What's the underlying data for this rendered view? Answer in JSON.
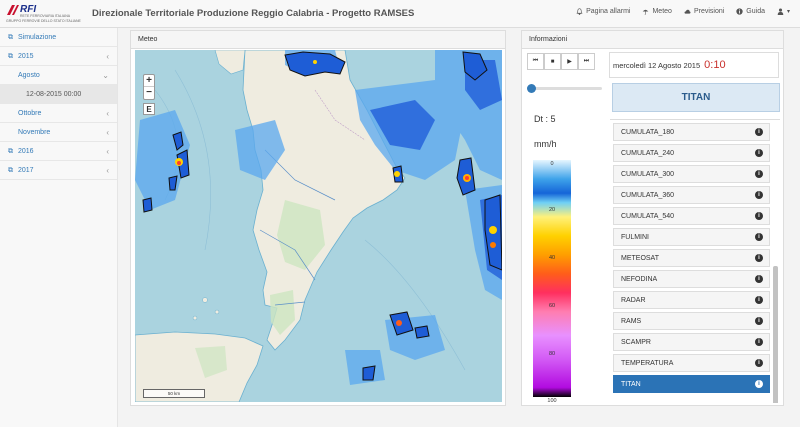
{
  "header": {
    "logo_text": "RFI",
    "logo_sub1": "RETE FERROVIARIA ITALIANA",
    "logo_sub2": "GRUPPO FERROVIE DELLO STATO ITALIANE",
    "title": "Direzionale Territoriale Produzione Reggio Calabria - Progetto RAMSES",
    "nav": [
      {
        "label": "Pagina allarmi",
        "icon": "bell-icon"
      },
      {
        "label": "Meteo",
        "icon": "umbrella-icon"
      },
      {
        "label": "Previsioni",
        "icon": "cloud-icon"
      },
      {
        "label": "Guida",
        "icon": "info-icon"
      },
      {
        "label": "",
        "icon": "user-icon"
      }
    ]
  },
  "sidebar": {
    "items": [
      {
        "label": "Simulazione",
        "level": 1,
        "icon": "sitemap-icon"
      },
      {
        "label": "2015",
        "level": 1,
        "icon": "sitemap-icon"
      },
      {
        "label": "Agosto",
        "level": 2
      },
      {
        "label": "12-08-2015 00:00",
        "level": 3
      },
      {
        "label": "Ottobre",
        "level": 2
      },
      {
        "label": "Novembre",
        "level": 2
      },
      {
        "label": "2016",
        "level": 1,
        "icon": "sitemap-icon"
      },
      {
        "label": "2017",
        "level": 1,
        "icon": "sitemap-icon"
      }
    ]
  },
  "meteo": {
    "title": "Meteo",
    "zoom_in": "+",
    "zoom_out": "−",
    "layer_btn": "E",
    "scale_label": "50 km"
  },
  "info": {
    "title": "Informazioni",
    "date": "mercoledì 12 Agosto 2015",
    "time": "0:10",
    "titan_label": "TITAN",
    "dt": "Dt : 5",
    "unit": "mm/h",
    "colorbar_ticks": [
      "0",
      "20",
      "40",
      "60",
      "80",
      "100"
    ],
    "slider_position": 0,
    "layers": [
      {
        "label": "CUMULATA_180",
        "active": false
      },
      {
        "label": "CUMULATA_240",
        "active": false
      },
      {
        "label": "CUMULATA_300",
        "active": false
      },
      {
        "label": "CUMULATA_360",
        "active": false
      },
      {
        "label": "CUMULATA_540",
        "active": false
      },
      {
        "label": "FULMINI",
        "active": false
      },
      {
        "label": "METEOSAT",
        "active": false
      },
      {
        "label": "NEFODINA",
        "active": false
      },
      {
        "label": "RADAR",
        "active": false
      },
      {
        "label": "RAMS",
        "active": false
      },
      {
        "label": "SCAMPR",
        "active": false
      },
      {
        "label": "TEMPERATURA",
        "active": false
      },
      {
        "label": "TITAN",
        "active": true
      }
    ]
  }
}
